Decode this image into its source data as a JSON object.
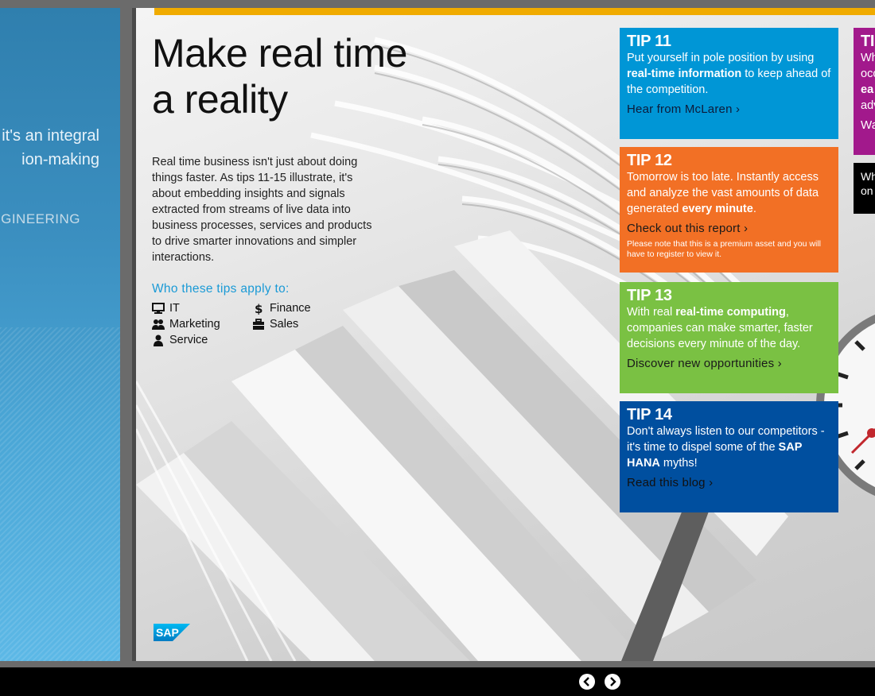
{
  "prev_page": {
    "line1": "it's an integral",
    "line2": "ion-making",
    "line3": "NGINEERING"
  },
  "main": {
    "headline_line1": "Make real time",
    "headline_line2": "a reality",
    "intro": "Real time business isn't just about doing things faster. As tips 11-15 illustrate, it's about embedding insights and signals extracted from streams of live data into business processes, services and products to drive smarter innovations and simpler interactions.",
    "applies_heading": "Who these tips apply to:",
    "audiences": {
      "it": {
        "label": "IT",
        "icon": "monitor-icon"
      },
      "finance": {
        "label": "Finance",
        "icon": "dollar-icon"
      },
      "marketing": {
        "label": "Marketing",
        "icon": "people-icon"
      },
      "sales": {
        "label": "Sales",
        "icon": "briefcase-icon"
      },
      "service": {
        "label": "Service",
        "icon": "person-icon"
      }
    },
    "logo_text": "SAP"
  },
  "tips": {
    "tip11": {
      "number": "TIP 11",
      "body_a": "Put yourself in pole position by using ",
      "body_bold": "real-time information",
      "body_b": " to keep ahead of the competition.",
      "link": "Hear from McLaren ›",
      "color": "#0096d6"
    },
    "tip12": {
      "number": "TIP 12",
      "body_a": "Tomorrow is too late. Instantly access and analyze the vast amounts of data generated ",
      "body_bold": "every minute",
      "body_b": ".",
      "link": "Check out this report ›",
      "note": "Please note that this is a premium asset and you will have to register to view it.",
      "color": "#f27025"
    },
    "tip13": {
      "number": "TIP 13",
      "body_a": "With real ",
      "body_bold": "real-time computing",
      "body_b": ", companies can make smarter, faster decisions every minute of the day.",
      "link": "Discover new opportunities ›",
      "color": "#7ac143"
    },
    "tip14": {
      "number": "TIP 14",
      "body_a": "Don't always listen to our competitors - it's time to dispel some of the ",
      "body_bold": "SAP HANA",
      "body_b": " myths!",
      "link": "Read this blog ›",
      "color": "#004f9f"
    },
    "tip15_partial": {
      "number": "TI",
      "line1": "Wh",
      "line2": "occ",
      "line3": "ea",
      "line4": "adv",
      "line5": "Wa",
      "color": "#a2198c"
    },
    "tip16_partial": {
      "line1": "Wh",
      "line2": "on"
    }
  },
  "nav": {
    "prev_icon": "chevron-left-icon",
    "next_icon": "chevron-right-icon"
  }
}
